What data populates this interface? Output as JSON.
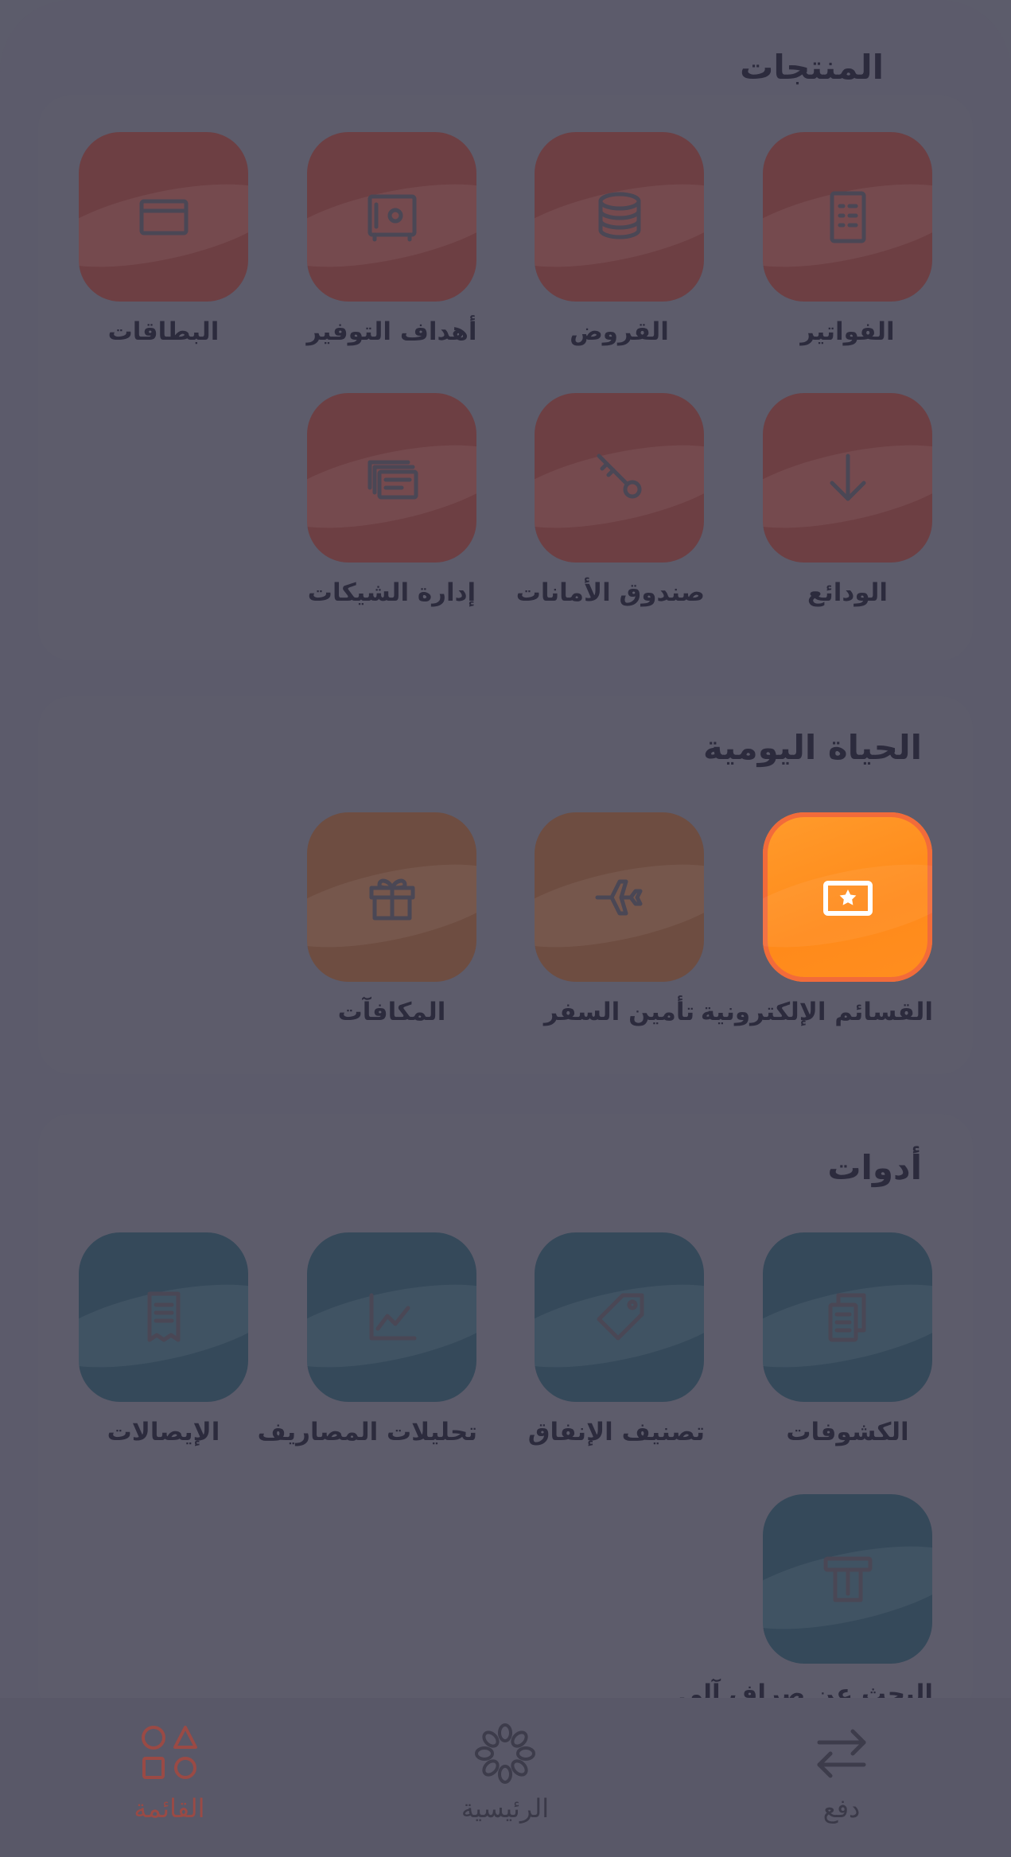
{
  "sections": [
    {
      "title": "المنتجات",
      "items": [
        {
          "label": "الفواتير",
          "icon": "invoice-icon",
          "color": "#6d3f43"
        },
        {
          "label": "القروض",
          "icon": "coins-stack-icon",
          "color": "#6d3f43"
        },
        {
          "label": "أهداف التوفير",
          "icon": "safe-icon",
          "color": "#6d3f43"
        },
        {
          "label": "البطاقات",
          "icon": "card-icon",
          "color": "#6d3f43"
        },
        {
          "label": "الودائع",
          "icon": "arrow-down-icon",
          "color": "#6d3f43"
        },
        {
          "label": "صندوق الأمانات",
          "icon": "key-icon",
          "color": "#6d3f43"
        },
        {
          "label": "إدارة الشيكات",
          "icon": "cheques-icon",
          "color": "#6d3f43"
        }
      ]
    },
    {
      "title": "الحياة اليومية",
      "items": [
        {
          "label": "القسائم الإلكترونية",
          "icon": "voucher-icon",
          "color": "#ff8c1e"
        },
        {
          "label": "تأمين السفر",
          "icon": "airplane-icon",
          "color": "#6e4d41"
        },
        {
          "label": "المكافآت",
          "icon": "gift-icon",
          "color": "#6e4d41"
        }
      ]
    },
    {
      "title": "أدوات",
      "items": [
        {
          "label": "الكشوفات",
          "icon": "statements-icon",
          "color": "#35495a"
        },
        {
          "label": "تصنيف الإنفاق",
          "icon": "tag-icon",
          "color": "#35495a"
        },
        {
          "label": "تحليلات المصاريف",
          "icon": "line-chart-icon",
          "color": "#35495a"
        },
        {
          "label": "الإيصالات",
          "icon": "receipt-icon",
          "color": "#35495a"
        },
        {
          "label": "البحث عن صراف آلي",
          "icon": "atm-icon",
          "color": "#35495a"
        }
      ]
    }
  ],
  "nav": {
    "items": [
      {
        "label": "القائمة",
        "icon": "shapes-menu-icon",
        "active": true
      },
      {
        "label": "الرئيسية",
        "icon": "home-logo-icon",
        "active": false
      },
      {
        "label": "دفع",
        "icon": "transfer-arrows-icon",
        "active": false
      }
    ]
  }
}
